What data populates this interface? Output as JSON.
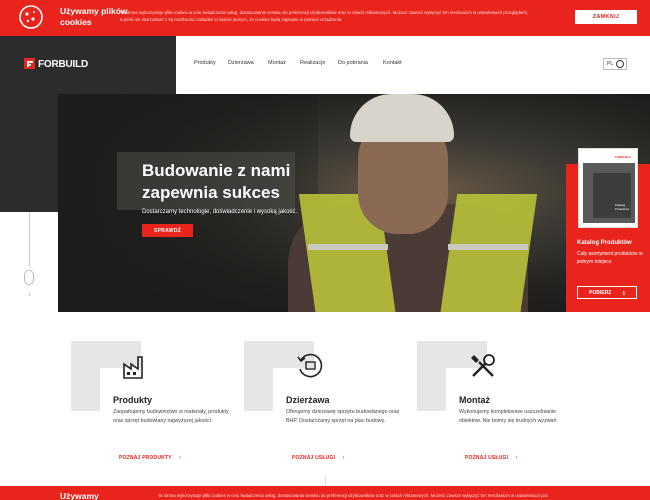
{
  "colors": {
    "brand": "#e8241c",
    "dark": "#2c2c2c"
  },
  "cookie": {
    "icon": "cookie-icon",
    "title": "Używamy plików cookies",
    "text": "Ta strona wykorzystuje pliki cookies w celu świadczenia usług, dostosowania serwisu do preferencji użytkowników oraz w celach reklamowych. Możesz zawsze wyłączyć ten mechanizm w ustawieniach przeglądarki, a jeżeli nie skorzystasz z tej możliwości zakładać to będzie jednym, że cookies będą zapisane w pamięci urządzenia.",
    "close_label": "ZAMKNIJ"
  },
  "header": {
    "logo_text": "FORBUILD",
    "nav": [
      "Produkty",
      "Dzierżawa",
      "Montaż",
      "Realizacje",
      "Do pobrania",
      "Kontakt"
    ],
    "lang": "PL"
  },
  "hero": {
    "title": "Budowanie z nami zapewnia sukces",
    "subtitle": "Dostarczamy technologie, doświadczenie i wysoką jakość.",
    "cta": "SPRAWDŹ"
  },
  "catalog": {
    "cover_text": "Katalog Produktów",
    "title": "Katalog Produktów",
    "desc": "Cały asortyment produktów w jednym miejscu",
    "button": "POBIERZ"
  },
  "services": [
    {
      "icon": "factory-icon",
      "title": "Produkty",
      "desc": "Zaopatrujemy budownictwo w materiały, produkty oraz sprzęt budowlany najwyższej jakości.",
      "link": "POZNAJ PRODUKTY"
    },
    {
      "icon": "rental-icon",
      "title": "Dzierżawa",
      "desc": "Oferujemy dzierżawę sprzętu budowlanego oraz BHP. Dostarczamy sprzęt na plac budowy.",
      "link": "POZNAJ USŁUGI"
    },
    {
      "icon": "tools-icon",
      "title": "Montaż",
      "desc": "Wykonujemy kompleksowe uszczelnianie obiektów. Nie boimy się trudnych wyzwań.",
      "link": "POZNAJ USŁUGI"
    }
  ],
  "cookie_bottom": {
    "title": "Używamy",
    "text": "Ta strona wykorzystuje pliki cookies w celu świadczenia usług, dostosowania serwisu do preferencji użytkowników oraz w celach reklamowych. Możesz zawsze wyłączyć ten mechanizm w ustawieniach przeglądarki."
  }
}
